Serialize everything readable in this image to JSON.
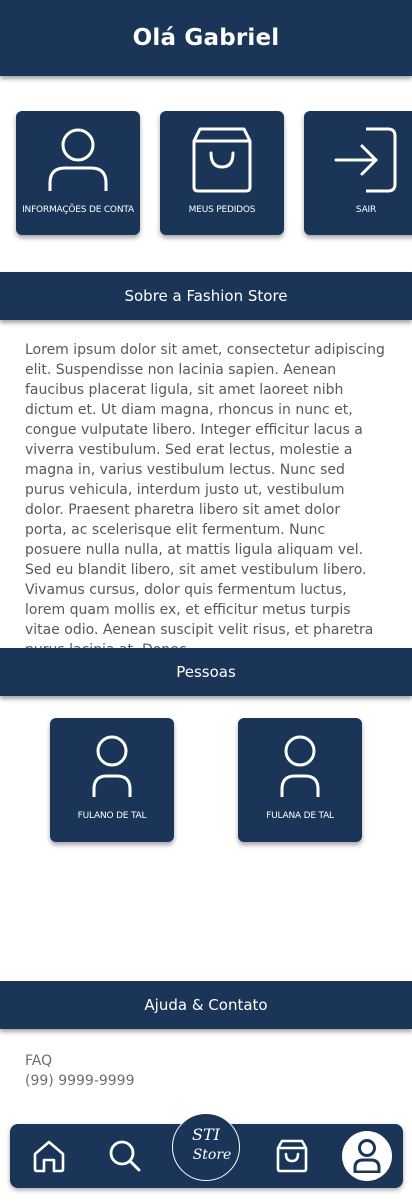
{
  "header": {
    "title": "Olá Gabriel"
  },
  "menu_tiles": [
    {
      "label": "INFORMAÇÕES DE CONTA",
      "icon": "user-icon"
    },
    {
      "label": "MEUS PEDIDOS",
      "icon": "shopping-bag-icon"
    },
    {
      "label": "SAIR",
      "icon": "logout-icon"
    }
  ],
  "about": {
    "title": "Sobre a Fashion Store",
    "text": "Lorem ipsum dolor sit amet, consectetur adipiscing elit. Suspendisse non lacinia sapien. Aenean faucibus placerat ligula, sit amet laoreet nibh dictum et. Ut diam magna, rhoncus in nunc et, congue vulputate libero. Integer efficitur lacus a viverra vestibulum. Sed erat lectus, molestie a magna in, varius vestibulum lectus. Nunc sed purus vehicula, interdum justo ut, vestibulum dolor. Praesent pharetra libero sit amet dolor porta, ac scelerisque elit fermentum. Nunc posuere nulla nulla, at mattis ligula aliquam vel. Sed eu blandit libero, sit amet vestibulum libero. Vivamus cursus, dolor quis fermentum luctus, lorem quam mollis ex, et efficitur metus turpis vitae odio. Aenean suscipit velit risus, et pharetra purus lacinia at. Donec"
  },
  "people": {
    "title": "Pessoas",
    "items": [
      {
        "name": "FULANO DE TAL",
        "icon": "user-icon"
      },
      {
        "name": "FULANA DE TAL",
        "icon": "user-icon"
      }
    ]
  },
  "help": {
    "title": "Ajuda & Contato",
    "faq": "FAQ",
    "phone": "(99) 9999-9999"
  },
  "bottom_nav": {
    "logo_line1": "STI",
    "logo_line2": "Store",
    "items": [
      "home-icon",
      "search-icon",
      "logo",
      "cart-icon",
      "profile-icon"
    ]
  },
  "colors": {
    "primary": "#1a3557",
    "background": "#ffffff",
    "body_text": "#555a60"
  }
}
